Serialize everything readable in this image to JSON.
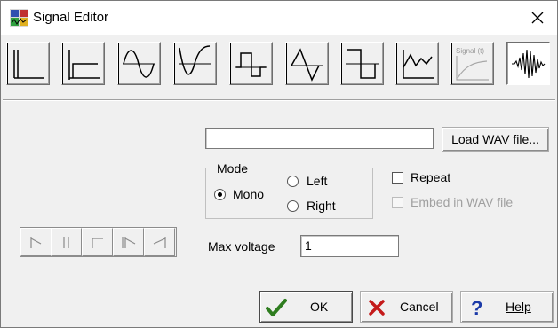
{
  "window": {
    "title": "Signal Editor"
  },
  "toolbar": {
    "tools": [
      {
        "name": "impulse",
        "icon": "impulse-signal-icon"
      },
      {
        "name": "step",
        "icon": "step-signal-icon"
      },
      {
        "name": "sine",
        "icon": "sine-wave-icon"
      },
      {
        "name": "negative-sine",
        "icon": "inverted-sine-icon"
      },
      {
        "name": "square-pulse",
        "icon": "square-pulse-icon"
      },
      {
        "name": "triangle",
        "icon": "triangle-wave-icon"
      },
      {
        "name": "square-wave",
        "icon": "square-wave-icon"
      },
      {
        "name": "arbitrary",
        "icon": "arbitrary-signal-icon"
      },
      {
        "name": "signal-t",
        "icon": "signal-function-icon",
        "label": "Signal (t)"
      },
      {
        "name": "wav",
        "icon": "wav-waveform-icon",
        "active": true
      }
    ]
  },
  "file": {
    "path_value": "",
    "load_button_label": "Load WAV file..."
  },
  "mode": {
    "group_label": "Mode",
    "options": [
      {
        "label": "Mono",
        "checked": true
      },
      {
        "label": "Left",
        "checked": false
      },
      {
        "label": "Right",
        "checked": false
      }
    ]
  },
  "options": {
    "repeat_label": "Repeat",
    "repeat_checked": false,
    "embed_label": "Embed in WAV file",
    "embed_checked": false,
    "embed_enabled": false
  },
  "voltage": {
    "label": "Max voltage",
    "value": "1"
  },
  "buttons": {
    "ok_label": "OK",
    "cancel_label": "Cancel",
    "help_label": "Help"
  },
  "colors": {
    "ok_check": "#2e7d1f",
    "cancel_x": "#c41a1a",
    "help_q": "#1b3aa8"
  }
}
